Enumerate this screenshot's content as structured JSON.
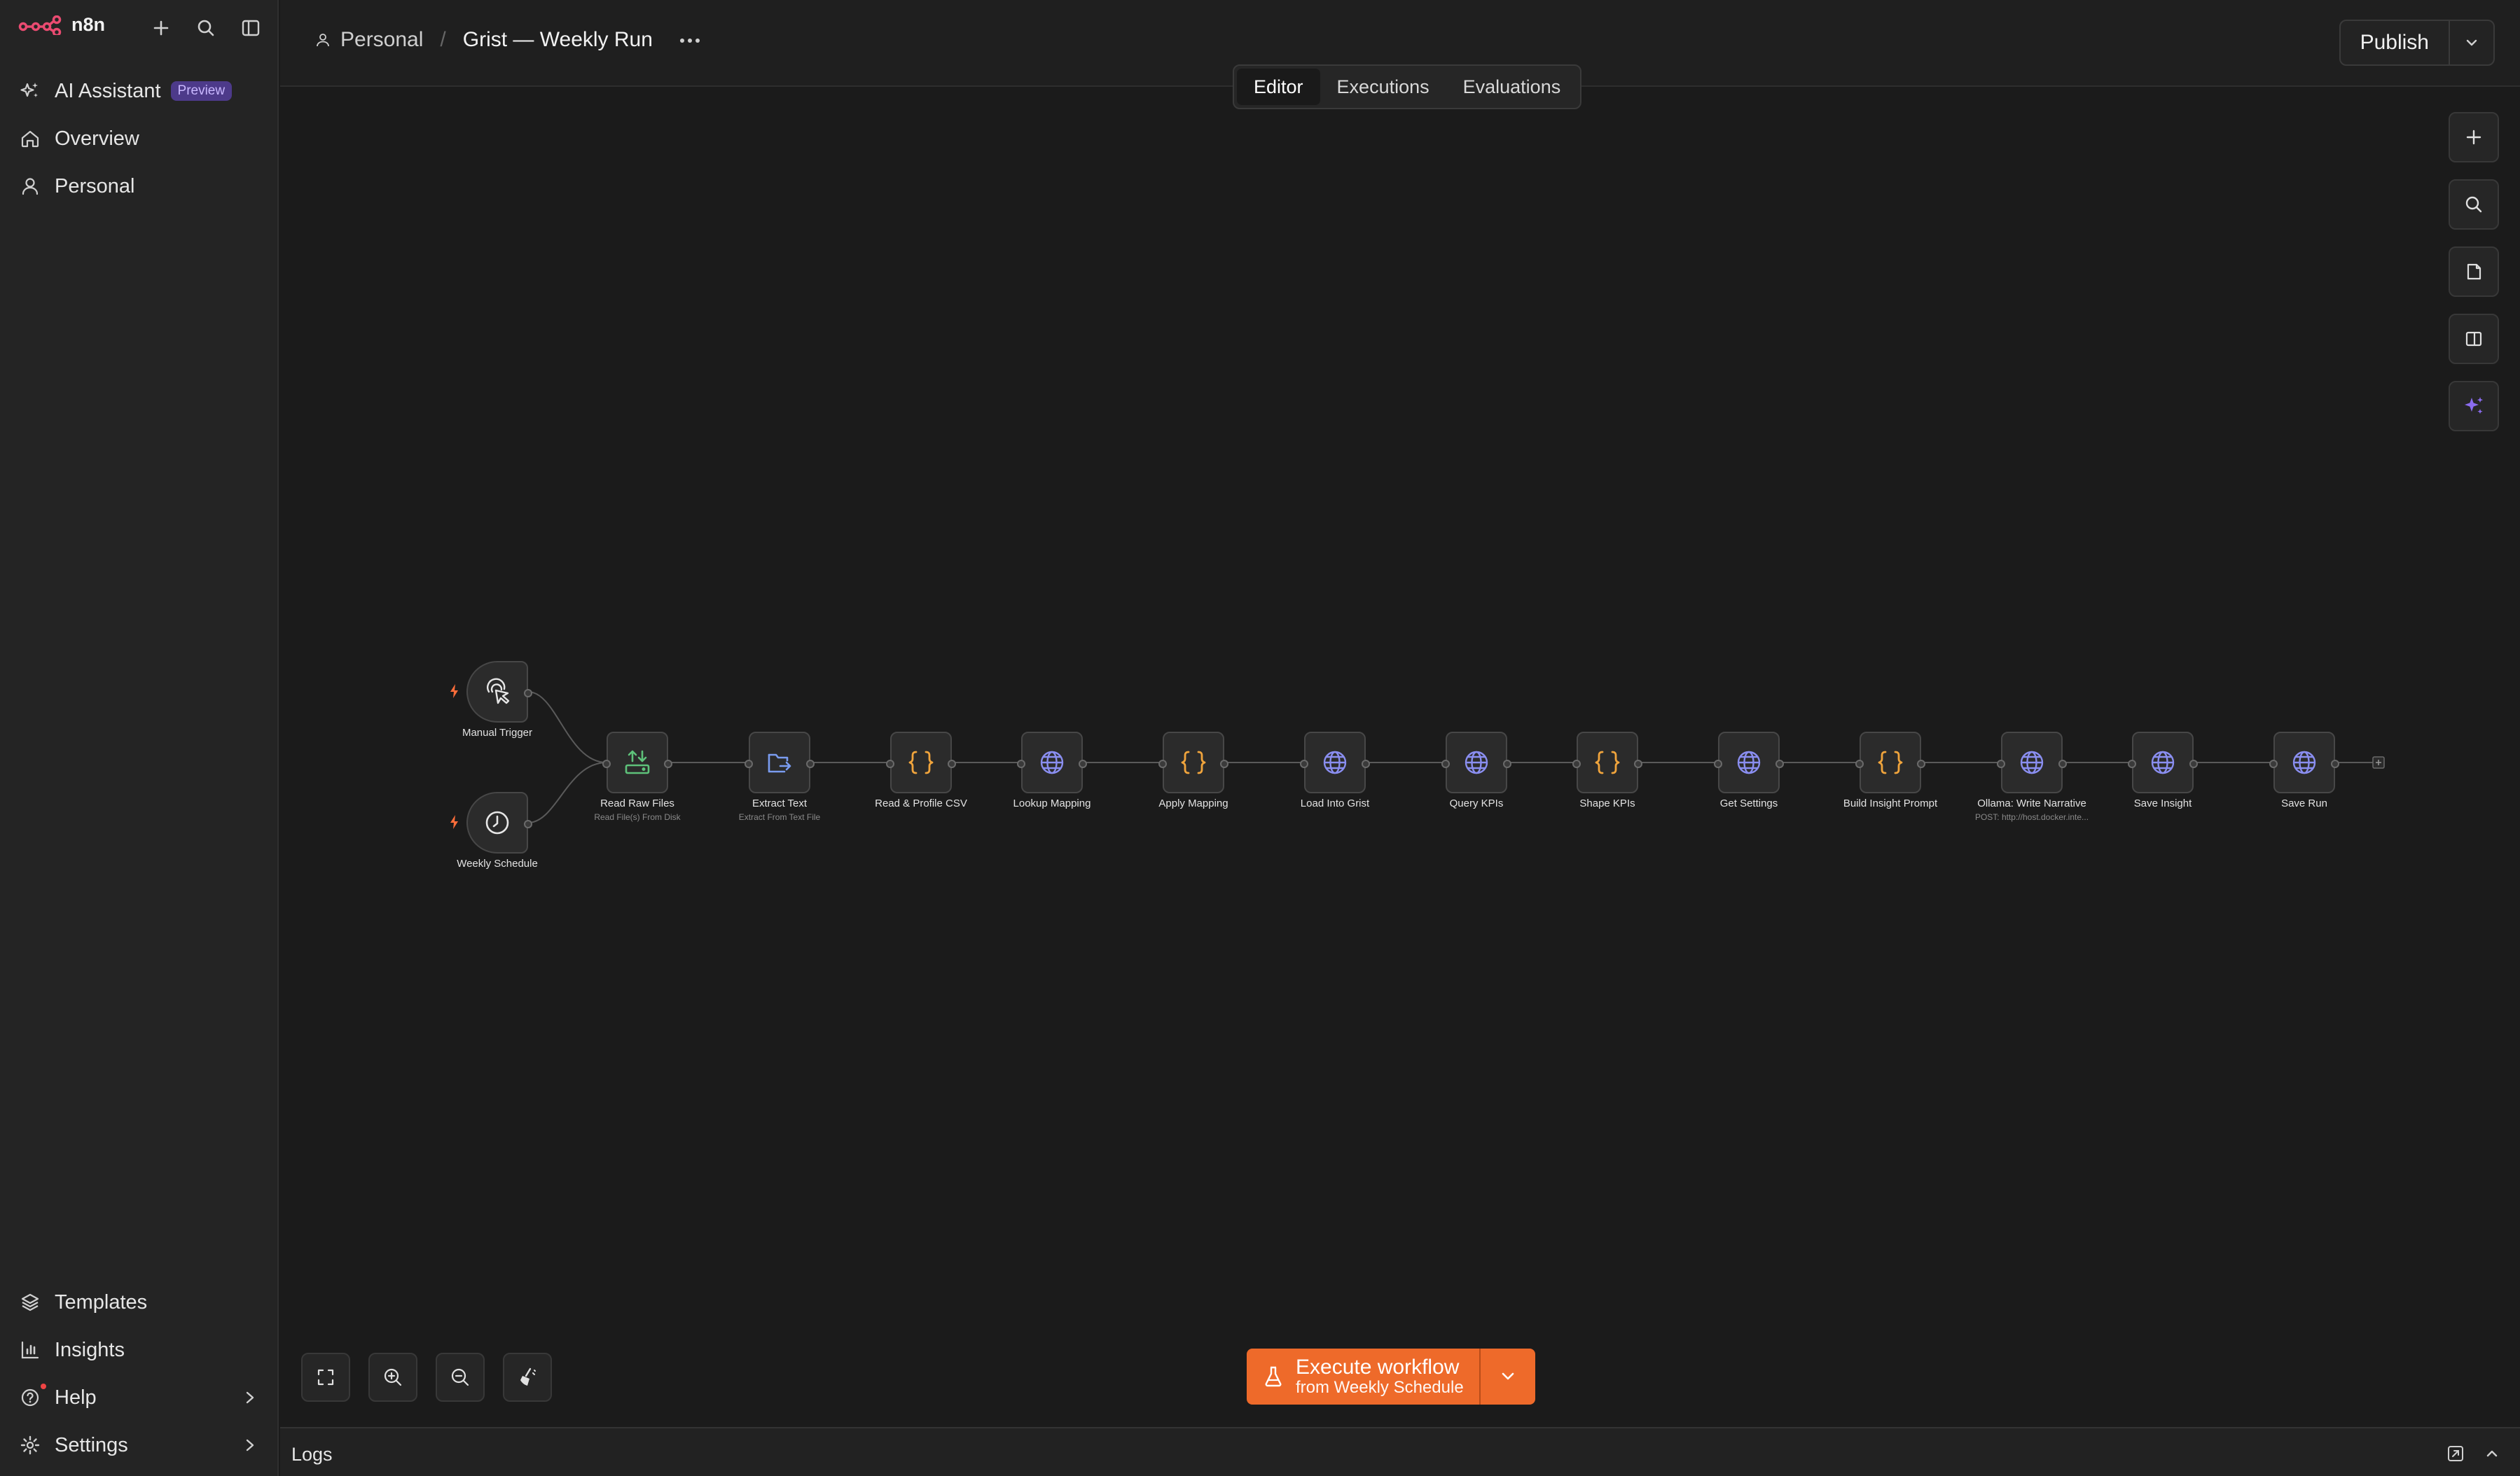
{
  "app": {
    "name": "n8n"
  },
  "sidebar": {
    "top_items": [
      {
        "label": "AI Assistant",
        "badge": "Preview"
      },
      {
        "label": "Overview"
      },
      {
        "label": "Personal"
      }
    ],
    "bottom_items": [
      {
        "label": "Templates"
      },
      {
        "label": "Insights"
      },
      {
        "label": "Help"
      },
      {
        "label": "Settings"
      }
    ]
  },
  "header": {
    "project": "Personal",
    "workflow_title": "Grist — Weekly Run",
    "publish_label": "Publish",
    "tabs": [
      {
        "label": "Editor",
        "active": true
      },
      {
        "label": "Executions",
        "active": false
      },
      {
        "label": "Evaluations",
        "active": false
      }
    ]
  },
  "nodes": [
    {
      "label": "Manual Trigger",
      "subtitle": "",
      "icon": "cursor-click-icon"
    },
    {
      "label": "Weekly Schedule",
      "subtitle": "",
      "icon": "clock-icon"
    },
    {
      "label": "Read Raw Files",
      "subtitle": "Read File(s) From Disk",
      "icon": "file-upload-icon"
    },
    {
      "label": "Extract Text",
      "subtitle": "Extract From Text File",
      "icon": "file-export-icon"
    },
    {
      "label": "Read & Profile CSV",
      "subtitle": "",
      "icon": "code-braces-icon"
    },
    {
      "label": "Lookup Mapping",
      "subtitle": "",
      "icon": "globe-icon"
    },
    {
      "label": "Apply Mapping",
      "subtitle": "",
      "icon": "code-braces-icon"
    },
    {
      "label": "Load Into Grist",
      "subtitle": "",
      "icon": "globe-icon"
    },
    {
      "label": "Query KPIs",
      "subtitle": "",
      "icon": "globe-icon"
    },
    {
      "label": "Shape KPIs",
      "subtitle": "",
      "icon": "code-braces-icon"
    },
    {
      "label": "Get Settings",
      "subtitle": "",
      "icon": "globe-icon"
    },
    {
      "label": "Build Insight Prompt",
      "subtitle": "",
      "icon": "code-braces-icon"
    },
    {
      "label": "Ollama: Write Narrative",
      "subtitle": "POST: http://host.docker.inte...",
      "icon": "globe-icon"
    },
    {
      "label": "Save Insight",
      "subtitle": "",
      "icon": "globe-icon"
    },
    {
      "label": "Save Run",
      "subtitle": "",
      "icon": "globe-icon"
    }
  ],
  "execute": {
    "line1": "Execute workflow",
    "line2": "from Weekly Schedule"
  },
  "logs": {
    "label": "Logs"
  },
  "colors": {
    "accent": "#ee6a2a",
    "code_icon": "#f0a43c",
    "http_icon": "#8a8ef0",
    "file_icon": "#5ec27a",
    "file_export_icon": "#7a9cf0",
    "trigger_bolt": "#ff6d3a",
    "logo": "#ea4b71"
  }
}
